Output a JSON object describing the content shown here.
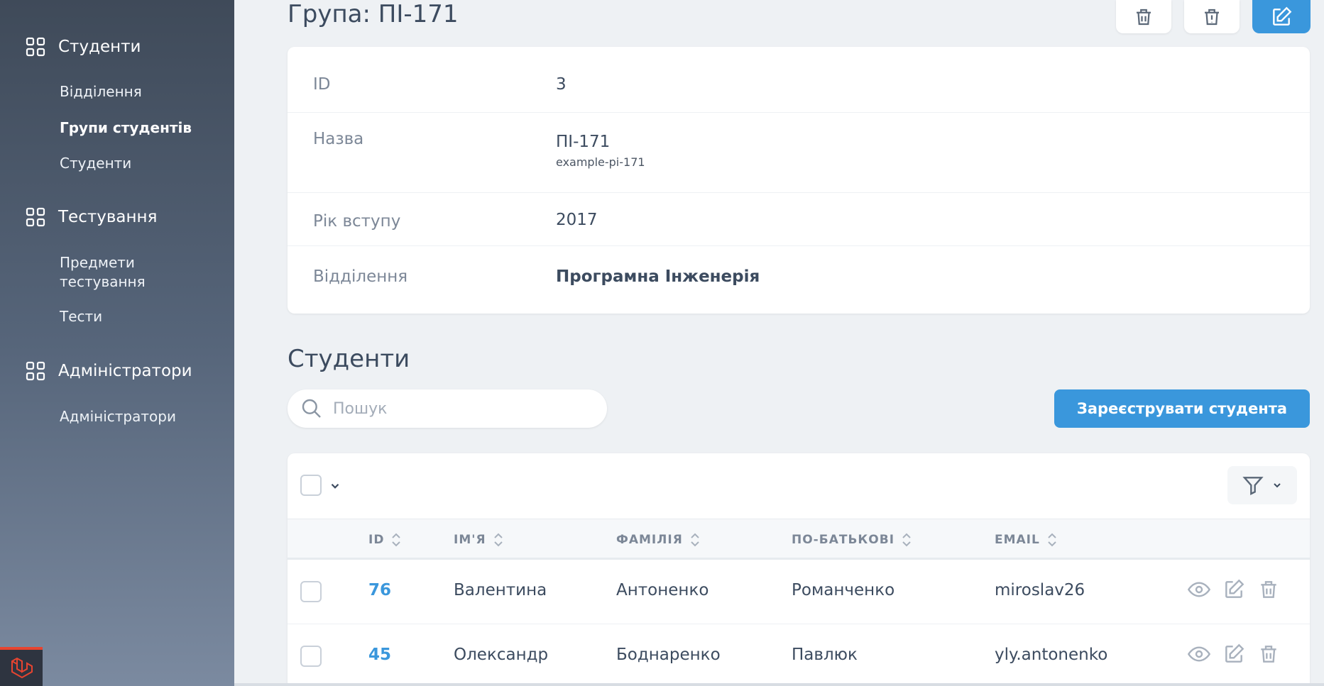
{
  "sidebar": {
    "sections": [
      {
        "label": "Студенти",
        "items": [
          "Відділення",
          "Групи студентів",
          "Студенти"
        ],
        "active": "Групи студентів"
      },
      {
        "label": "Тестування",
        "items": [
          "Предмети тестування",
          "Тести"
        ]
      },
      {
        "label": "Адміністратори",
        "items": [
          "Адміністратори"
        ]
      }
    ],
    "logo_icon": "laravel-logo-icon"
  },
  "header": {
    "title": "Група: ПІ-171",
    "actions": [
      "delete-icon",
      "force-delete-icon",
      "edit-icon"
    ]
  },
  "details": {
    "rows": [
      {
        "label": "ID",
        "value": "3"
      },
      {
        "label": "Назва",
        "value": "ПІ-171",
        "sub": "example-pi-171"
      },
      {
        "label": "Рік вступу",
        "value": "2017"
      },
      {
        "label": "Відділення",
        "value": "Програмна Інженерія"
      }
    ]
  },
  "students": {
    "title": "Студенти",
    "search_placeholder": "Пошук",
    "register_button": "Зареєструвати студента",
    "columns": [
      "ID",
      "ІМ'Я",
      "ФАМІЛІЯ",
      "ПО-БАТЬКОВІ",
      "EMAIL"
    ],
    "rows": [
      {
        "id": "76",
        "first": "Валентина",
        "last": "Антоненко",
        "middle": "Романченко",
        "email": "miroslav26"
      },
      {
        "id": "45",
        "first": "Олександр",
        "last": "Боднаренко",
        "middle": "Павлюк",
        "email": "yly.antonenko"
      }
    ]
  },
  "colors": {
    "accent": "#3a97dc",
    "sidebar_top": "#3f4a59",
    "sidebar_bottom": "#7b8aa0",
    "background": "#eef1f4"
  }
}
